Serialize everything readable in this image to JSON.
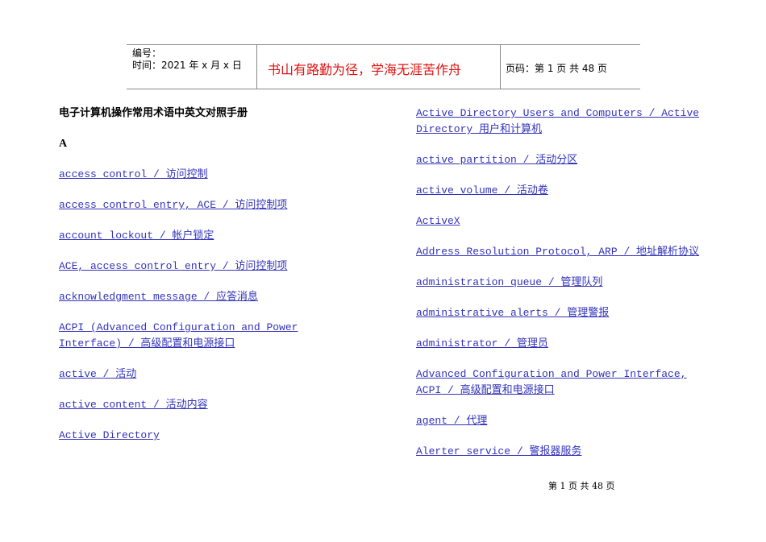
{
  "header": {
    "number_label": "编号：",
    "date_label": "时间：2021 年 x 月 x 日",
    "motto": "书山有路勤为径，学海无涯苦作舟",
    "page_info": "页码：第 1 页  共 48 页"
  },
  "document": {
    "title": "电子计算机操作常用术语中英文对照手册",
    "section_letter": "A",
    "left_entries": [
      "access control / 访问控制",
      "access control entry, ACE / 访问控制项",
      "account lockout / 帐户锁定",
      "ACE, access control entry / 访问控制项",
      "acknowledgment message / 应答消息",
      "ACPI (Advanced Configuration and Power Interface) / 高级配置和电源接口",
      "active / 活动",
      "active content / 活动内容",
      "Active Directory"
    ],
    "right_entries": [
      "Active Directory Users and Computers / Active Directory 用户和计算机",
      "active partition / 活动分区",
      "active volume / 活动卷",
      "ActiveX",
      "Address Resolution Protocol, ARP / 地址解析协议",
      "administration queue / 管理队列",
      "administrative alerts / 管理警报",
      "administrator / 管理员",
      "Advanced Configuration and Power Interface, ACPI / 高级配置和电源接口",
      "agent / 代理",
      "Alerter service / 警报器服务"
    ]
  },
  "footer": {
    "page_text": "第 1 页 共 48 页"
  }
}
